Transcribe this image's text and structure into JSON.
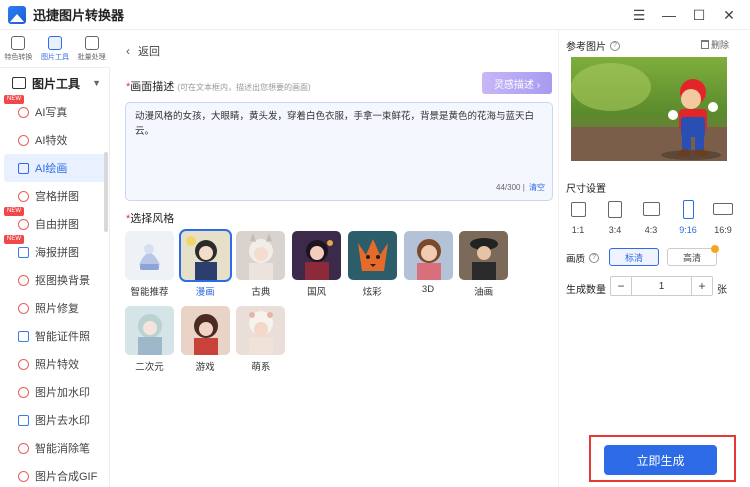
{
  "app": {
    "title": "迅捷图片转换器"
  },
  "window_controls": {
    "menu": "☰",
    "minimize": "—",
    "maximize": "☐",
    "close": "✕"
  },
  "top_tabs": [
    {
      "label": "特色转换",
      "active": false
    },
    {
      "label": "图片工具",
      "active": true
    },
    {
      "label": "批量处理",
      "active": false
    }
  ],
  "sidebar": {
    "section_title": "图片工具",
    "items": [
      {
        "label": "AI写真",
        "new": true
      },
      {
        "label": "AI特效",
        "new": false
      },
      {
        "label": "AI绘画",
        "new": false,
        "active": true
      },
      {
        "label": "宫格拼图",
        "new": false
      },
      {
        "label": "自由拼图",
        "new": true
      },
      {
        "label": "海报拼图",
        "new": true
      },
      {
        "label": "抠图换背景",
        "new": false
      },
      {
        "label": "照片修复",
        "new": false
      },
      {
        "label": "智能证件照",
        "new": false
      },
      {
        "label": "照片特效",
        "new": false
      },
      {
        "label": "图片加水印",
        "new": false
      },
      {
        "label": "图片去水印",
        "new": false
      },
      {
        "label": "智能消除笔",
        "new": false
      },
      {
        "label": "图片合成GIF",
        "new": false
      }
    ],
    "new_badge": "NEW"
  },
  "main": {
    "back_label": "返回",
    "desc_label": "画面描述",
    "desc_hint": "(可在文本框内，描述出您想要的画面)",
    "inspire_button": "灵感描述 ›",
    "desc_text": "动漫风格的女孩，大眼睛，黄头发，穿着白色衣服，手拿一束鲜花，背景是黄色的花海与蓝天白云。",
    "counter": "44/300",
    "clear_label": "清空",
    "style_label": "选择风格",
    "styles": [
      {
        "name": "智能推荐",
        "selected": false
      },
      {
        "name": "漫画",
        "selected": true
      },
      {
        "name": "古典",
        "selected": false
      },
      {
        "name": "国风",
        "selected": false
      },
      {
        "name": "炫彩",
        "selected": false
      },
      {
        "name": "3D",
        "selected": false
      },
      {
        "name": "油画",
        "selected": false
      },
      {
        "name": "二次元",
        "selected": false
      },
      {
        "name": "游戏",
        "selected": false
      },
      {
        "name": "萌系",
        "selected": false
      }
    ]
  },
  "right": {
    "ref_label": "参考图片",
    "delete_label": "删除",
    "size_label": "尺寸设置",
    "ratios": [
      {
        "label": "1:1",
        "selected": false
      },
      {
        "label": "3:4",
        "selected": false
      },
      {
        "label": "4:3",
        "selected": false
      },
      {
        "label": "9:16",
        "selected": true
      },
      {
        "label": "16:9",
        "selected": false
      }
    ],
    "quality_label": "画质",
    "quality_options": [
      {
        "label": "标清",
        "selected": true
      },
      {
        "label": "高清",
        "selected": false
      }
    ],
    "count_label": "生成数量",
    "count_value": "1",
    "count_unit": "张",
    "generate_button": "立即生成"
  },
  "colors": {
    "accent": "#2e6be6",
    "highlight_box": "#e53935"
  }
}
